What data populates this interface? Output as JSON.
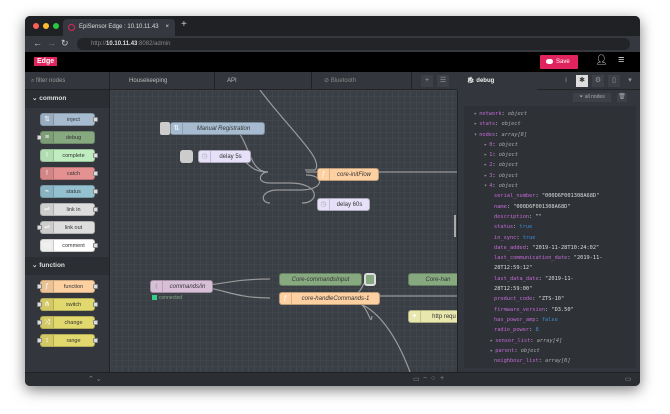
{
  "browser": {
    "tab_title": "EpiSensor Edge : 10.10.11.43",
    "url_prefix": "http://",
    "url_host": "10.10.11.43",
    "url_rest": ":8082/admin",
    "close": "×",
    "new_tab": "+"
  },
  "header": {
    "logo": "Edge",
    "save_label": "Save",
    "accent": "#e0245e"
  },
  "palette": {
    "filter_placeholder": "filter nodes",
    "categories": [
      {
        "label": "common",
        "nodes": [
          {
            "label": "inject",
            "color": "#a6bbcf",
            "icon": "arrows-icon"
          },
          {
            "label": "debug",
            "color": "#87a980",
            "icon": "list-icon"
          },
          {
            "label": "complete",
            "color": "#c0edc0",
            "icon": "exclamation-icon"
          },
          {
            "label": "catch",
            "color": "#e49191",
            "icon": "exclamation-icon"
          },
          {
            "label": "status",
            "color": "#94c1d0",
            "icon": "pulse-icon"
          },
          {
            "label": "link in",
            "color": "#dddddd",
            "icon": "link-icon"
          },
          {
            "label": "link out",
            "color": "#dddddd",
            "icon": "link-icon"
          },
          {
            "label": "comment",
            "color": "#ffffff",
            "icon": "comment-icon"
          }
        ]
      },
      {
        "label": "function",
        "nodes": [
          {
            "label": "function",
            "color": "#fdd0a2",
            "icon": "function-icon"
          },
          {
            "label": "switch",
            "color": "#e2d96e",
            "icon": "switch-icon"
          },
          {
            "label": "change",
            "color": "#e2d96e",
            "icon": "shuffle-icon"
          },
          {
            "label": "range",
            "color": "#e2d96e",
            "icon": "range-icon"
          }
        ]
      }
    ]
  },
  "flow_tabs": [
    "Housekeeping",
    "API",
    "Bluetooth"
  ],
  "flow": {
    "nodes": [
      {
        "label": "Manual Registration",
        "color": "#a6bbcf"
      },
      {
        "label": "delay 5s",
        "color": "#e6e0f8"
      },
      {
        "label": "core-initFlow",
        "color": "#fdd0a2"
      },
      {
        "label": "delay 60s",
        "color": "#e6e0f8"
      },
      {
        "label": "commands/in",
        "color": "#d8bfd8"
      },
      {
        "label": "Core-commandsInput",
        "color": "#87a980"
      },
      {
        "label": "core-handleCommands-1",
        "color": "#fdd0a2"
      },
      {
        "label": "Core-han",
        "color": "#87a980"
      },
      {
        "label": "http requ",
        "color": "#e7e7ae"
      }
    ],
    "status_connected": "connected"
  },
  "debug": {
    "tab_label": "debug",
    "filter_label": "all nodes",
    "lines": [
      {
        "indent": 0,
        "arrow": "▸",
        "key": "network",
        "type": "object"
      },
      {
        "indent": 0,
        "arrow": "▸",
        "key": "stats",
        "type": "object"
      },
      {
        "indent": 0,
        "arrow": "▾",
        "key": "nodes",
        "type": "array[8]"
      },
      {
        "indent": 1,
        "arrow": "▸",
        "key": "0",
        "type": "object"
      },
      {
        "indent": 1,
        "arrow": "▸",
        "key": "1",
        "type": "object"
      },
      {
        "indent": 1,
        "arrow": "▸",
        "key": "2",
        "type": "object"
      },
      {
        "indent": 1,
        "arrow": "▸",
        "key": "3",
        "type": "object"
      },
      {
        "indent": 1,
        "arrow": "▾",
        "key": "4",
        "type": "object"
      },
      {
        "indent": 2,
        "key": "serial_number",
        "str": "\"000D6F001308A68D\""
      },
      {
        "indent": 2,
        "key": "name",
        "str": "\"000D6F001308A68D\""
      },
      {
        "indent": 2,
        "key": "description",
        "str": "\"\""
      },
      {
        "indent": 2,
        "key": "status",
        "bool": "true"
      },
      {
        "indent": 2,
        "key": "in_sync",
        "bool": "true"
      },
      {
        "indent": 2,
        "key": "date_added",
        "str": "\"2019-11-28T10:24:02\""
      },
      {
        "indent": 2,
        "key": "last_communication_date",
        "str": "\"2019-11-"
      },
      {
        "indent": 2,
        "cont": "28T12:59:12\""
      },
      {
        "indent": 2,
        "key": "last_data_date",
        "str": "\"2019-11-"
      },
      {
        "indent": 2,
        "cont": "28T12:59:00\""
      },
      {
        "indent": 2,
        "key": "product_code",
        "str": "\"ZTS-10\""
      },
      {
        "indent": 2,
        "key": "firmware_version",
        "str": "\"D3.50\""
      },
      {
        "indent": 2,
        "key": "has_power_amp",
        "bool": "false"
      },
      {
        "indent": 2,
        "key": "radio_power",
        "bool": "8"
      },
      {
        "indent": 1.6,
        "arrow": "▸",
        "key": "sensor_list",
        "type": "array[4]"
      },
      {
        "indent": 1.6,
        "arrow": "▸",
        "key": "parent",
        "type": "object"
      },
      {
        "indent": 2,
        "key": "neighbour_list",
        "type": "array[0]"
      },
      {
        "indent": 2,
        "key": "child_list",
        "type": "array[0]"
      }
    ]
  }
}
